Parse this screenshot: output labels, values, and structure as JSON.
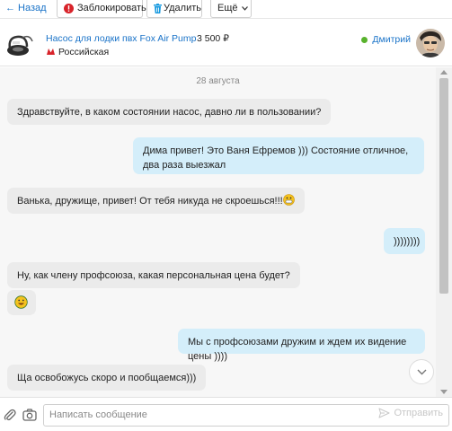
{
  "toolbar": {
    "back_label": "Назад",
    "block_label": "Заблокировать",
    "delete_label": "Удалить",
    "more_label": "Ещё"
  },
  "header": {
    "product_title": "Насос для лодки пвх Fox Air Pump",
    "price": "3 500 ₽",
    "metro_station": "Российская",
    "user_name": "Дмитрий",
    "user_online": true
  },
  "chat": {
    "date_label": "28 августа",
    "messages": [
      {
        "direction": "in",
        "text": "Здравствуйте, в каком состоянии насос, давно ли в пользовании?"
      },
      {
        "direction": "out",
        "text": "Дима привет! Это Ваня Ефремов ))) Состояние отличное, два раза выезжал"
      },
      {
        "direction": "in",
        "text": "Ванька, дружище, привет! От тебя никуда не скроешься!!!",
        "emoji": "grimacing-face"
      },
      {
        "direction": "out",
        "text": "))))))))"
      },
      {
        "direction": "in",
        "text": "Ну, как члену профсоюза, какая персональная цена будет?"
      },
      {
        "direction": "in",
        "text": "",
        "emoji": "grinning-face"
      },
      {
        "direction": "out",
        "text": "Мы с профсоюзами дружим и ждем их видение цены ))))"
      },
      {
        "direction": "in",
        "text": "Ща освобожусь скоро и пообщаемся)))"
      }
    ]
  },
  "composer": {
    "placeholder": "Написать сообщение",
    "send_label": "Отправить"
  },
  "colors": {
    "link": "#1a73c8",
    "incoming_bubble": "#ebebeb",
    "outgoing_bubble": "#d4eefa",
    "online": "#58b22c",
    "metro": "#d8232a",
    "block_icon": "#d8232a",
    "delete_icon": "#1a9be0"
  },
  "icons": [
    "arrow-left-icon",
    "block-icon",
    "trash-icon",
    "chevron-down-icon",
    "online-dot-icon",
    "metro-icon",
    "paperclip-icon",
    "camera-icon",
    "send-icon",
    "scroll-down-icon"
  ]
}
